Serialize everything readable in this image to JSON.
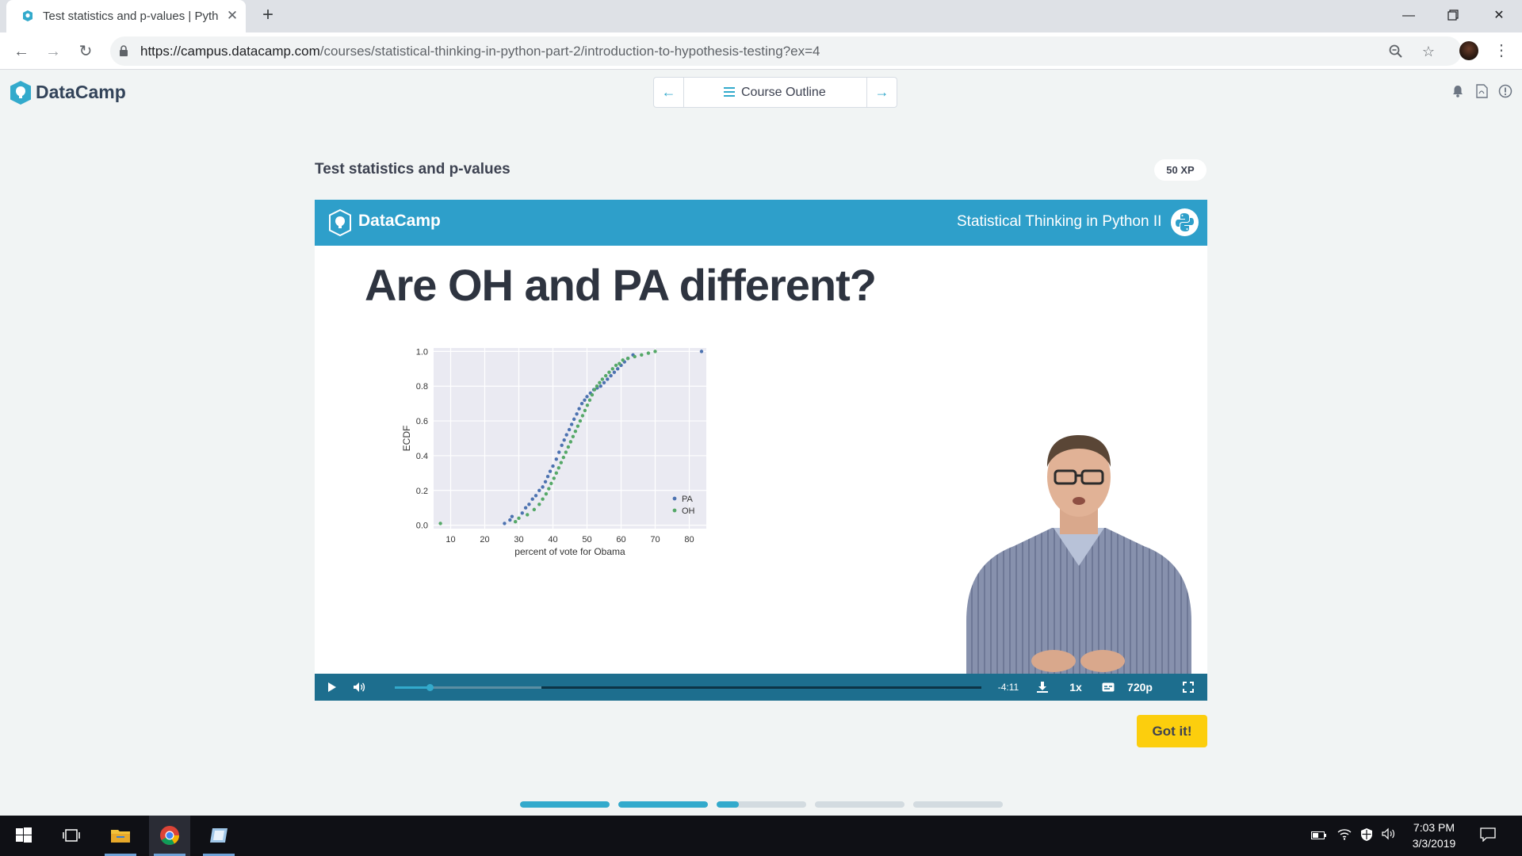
{
  "browser": {
    "tab_title": "Test statistics and p-values | Pyth",
    "url_host": "https://campus.datacamp.com",
    "url_path": "/courses/statistical-thinking-in-python-part-2/introduction-to-hypothesis-testing?ex=4"
  },
  "app": {
    "logo_text": "DataCamp",
    "outline_label": "Course Outline"
  },
  "exercise": {
    "title": "Test statistics and p-values",
    "xp": "50 XP"
  },
  "slide": {
    "brand": "DataCamp",
    "course": "Statistical Thinking in Python II",
    "heading": "Are OH and PA different?"
  },
  "player": {
    "time_remaining": "-4:11",
    "speed": "1x",
    "quality": "720p",
    "progress": 0.06,
    "buffered": 0.25
  },
  "actions": {
    "got_it": "Got it!"
  },
  "exercise_progress": [
    1,
    1,
    0.25,
    0,
    0
  ],
  "taskbar": {
    "time": "7:03 PM",
    "date": "3/3/2019"
  },
  "colors": {
    "pa": "#4c72b0",
    "oh": "#55a868",
    "accent": "#33aacc",
    "slide_bar": "#2e9fca",
    "got_it": "#fcce0d"
  },
  "chart_data": {
    "type": "scatter",
    "xlabel": "percent of vote for Obama",
    "ylabel": "ECDF",
    "xlim": [
      5,
      85
    ],
    "ylim": [
      -0.02,
      1.02
    ],
    "xticks": [
      10,
      20,
      30,
      40,
      50,
      60,
      70,
      80
    ],
    "yticks": [
      0.0,
      0.2,
      0.4,
      0.6,
      0.8,
      1.0
    ],
    "grid": true,
    "legend_position": "bottom-right",
    "series": [
      {
        "name": "PA",
        "x": [
          25.8,
          27.4,
          28.0,
          31.0,
          32.0,
          33.0,
          34.0,
          35.0,
          36.0,
          37.0,
          37.8,
          38.5,
          39.2,
          40.0,
          41.0,
          41.8,
          42.6,
          43.3,
          44.0,
          44.8,
          45.5,
          46.2,
          47.0,
          47.7,
          48.5,
          49.3,
          50.0,
          51.0,
          52.0,
          53.0,
          54.0,
          55.0,
          56.0,
          57.0,
          58.0,
          59.0,
          60.0,
          61.0,
          62.0,
          63.5,
          83.6
        ],
        "y": [
          0.01,
          0.03,
          0.05,
          0.07,
          0.1,
          0.12,
          0.15,
          0.17,
          0.2,
          0.22,
          0.25,
          0.28,
          0.31,
          0.34,
          0.38,
          0.42,
          0.46,
          0.49,
          0.52,
          0.55,
          0.58,
          0.61,
          0.64,
          0.67,
          0.7,
          0.72,
          0.74,
          0.76,
          0.78,
          0.79,
          0.8,
          0.82,
          0.84,
          0.86,
          0.88,
          0.9,
          0.92,
          0.94,
          0.96,
          0.98,
          1.0
        ]
      },
      {
        "name": "OH",
        "x": [
          7.0,
          29.0,
          30.0,
          32.5,
          34.5,
          36.0,
          37.0,
          38.0,
          38.8,
          39.5,
          40.3,
          41.0,
          41.7,
          42.4,
          43.1,
          43.8,
          44.5,
          45.2,
          45.9,
          46.6,
          47.3,
          48.0,
          48.7,
          49.4,
          50.1,
          50.8,
          51.5,
          52.2,
          52.9,
          53.7,
          54.5,
          55.5,
          56.5,
          57.5,
          58.5,
          59.5,
          60.5,
          62.0,
          64.0,
          66.0,
          68.0,
          70.0
        ],
        "y": [
          0.01,
          0.02,
          0.04,
          0.06,
          0.09,
          0.12,
          0.15,
          0.18,
          0.21,
          0.24,
          0.27,
          0.3,
          0.33,
          0.36,
          0.39,
          0.42,
          0.45,
          0.48,
          0.51,
          0.54,
          0.57,
          0.6,
          0.63,
          0.66,
          0.69,
          0.72,
          0.75,
          0.78,
          0.8,
          0.82,
          0.84,
          0.86,
          0.88,
          0.9,
          0.92,
          0.93,
          0.95,
          0.96,
          0.97,
          0.98,
          0.99,
          1.0
        ]
      }
    ]
  }
}
